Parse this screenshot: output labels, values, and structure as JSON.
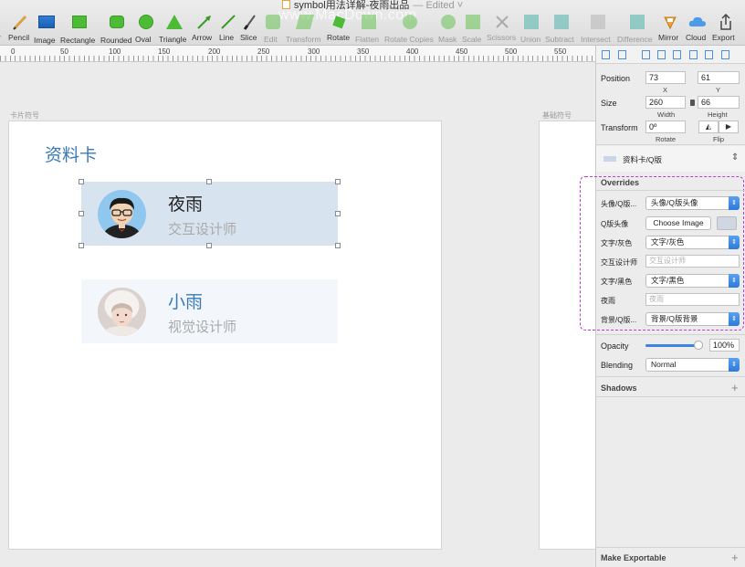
{
  "window": {
    "doc_title": "symbol用法详解-夜雨出品",
    "edited": "— Edited ˅",
    "watermark": "www.MacDown.com"
  },
  "toolbar": {
    "items": [
      {
        "label": "r",
        "icon": "insert-icon"
      },
      {
        "label": "Pencil",
        "icon": "pencil-icon"
      },
      {
        "label": "Image",
        "icon": "image-icon"
      },
      {
        "label": "Rectangle",
        "icon": "rectangle-icon"
      },
      {
        "label": "Rounded",
        "icon": "rounded-rect-icon"
      },
      {
        "label": "Oval",
        "icon": "oval-icon"
      },
      {
        "label": "Triangle",
        "icon": "triangle-icon"
      },
      {
        "label": "Arrow",
        "icon": "arrow-icon"
      },
      {
        "label": "Line",
        "icon": "line-icon"
      },
      {
        "label": "Slice",
        "icon": "slice-icon"
      },
      {
        "label": "Edit",
        "icon": "edit-icon"
      },
      {
        "label": "Transform",
        "icon": "transform-icon"
      },
      {
        "label": "Rotate",
        "icon": "rotate-icon"
      },
      {
        "label": "Flatten",
        "icon": "flatten-icon"
      },
      {
        "label": "Rotate Copies",
        "icon": "rotate-copies-icon"
      },
      {
        "label": "Mask",
        "icon": "mask-icon"
      },
      {
        "label": "Scale",
        "icon": "scale-icon"
      },
      {
        "label": "Scissors",
        "icon": "scissors-icon"
      },
      {
        "label": "Union",
        "icon": "union-icon"
      },
      {
        "label": "Subtract",
        "icon": "subtract-icon"
      },
      {
        "label": "Intersect",
        "icon": "intersect-icon"
      },
      {
        "label": "Difference",
        "icon": "difference-icon"
      },
      {
        "label": "Mirror",
        "icon": "mirror-icon"
      },
      {
        "label": "Cloud",
        "icon": "cloud-icon"
      },
      {
        "label": "Export",
        "icon": "export-icon"
      }
    ]
  },
  "ruler": {
    "marks": [
      "0",
      "50",
      "100",
      "150",
      "200",
      "250",
      "300",
      "350",
      "400",
      "450",
      "500",
      "550"
    ]
  },
  "canvas": {
    "artboard1_label": "卡片符号",
    "artboard2_label": "基础符号",
    "card_title": "资料卡",
    "cards": [
      {
        "name": "夜雨",
        "role": "交互设计师",
        "avatar": "cartoon-avatar"
      },
      {
        "name": "小雨",
        "role": "视觉设计师",
        "avatar": "photo-avatar"
      }
    ],
    "colors": {
      "accent": "#3a7ab8",
      "selected_card": "#d8e3f0",
      "plain_card": "#f3f6fa"
    }
  },
  "inspector": {
    "position": {
      "label": "Position",
      "x": "73",
      "y": "61",
      "x_label": "X",
      "y_label": "Y"
    },
    "size": {
      "label": "Size",
      "width": "260",
      "height": "66",
      "width_label": "Width",
      "height_label": "Height"
    },
    "transform": {
      "label": "Transform",
      "rotate": "0º",
      "rotate_label": "Rotate",
      "flip_label": "Flip"
    },
    "symbol_name": "资料卡/Q版",
    "overrides": {
      "header": "Overrides",
      "rows": [
        {
          "label": "头像/Q版...",
          "type": "select",
          "value": "头像/Q版头像"
        },
        {
          "label": "Q版头像",
          "type": "button",
          "value": "Choose Image"
        },
        {
          "label": "文字/灰色",
          "type": "select",
          "value": "文字/灰色"
        },
        {
          "label": "交互设计师",
          "type": "text",
          "value": "交互设计师"
        },
        {
          "label": "文字/黑色",
          "type": "select",
          "value": "文字/黑色"
        },
        {
          "label": "夜雨",
          "type": "text",
          "value": "夜雨"
        },
        {
          "label": "背景/Q版...",
          "type": "select",
          "value": "背景/Q版背景"
        }
      ]
    },
    "opacity": {
      "label": "Opacity",
      "value": "100%",
      "level": 1.0
    },
    "blending": {
      "label": "Blending",
      "value": "Normal"
    },
    "shadows": {
      "label": "Shadows"
    },
    "make_exportable": {
      "label": "Make Exportable"
    },
    "colors": {
      "select_arrow": "#2c7ad9",
      "overrides_highlight": "#c03ccf"
    }
  }
}
